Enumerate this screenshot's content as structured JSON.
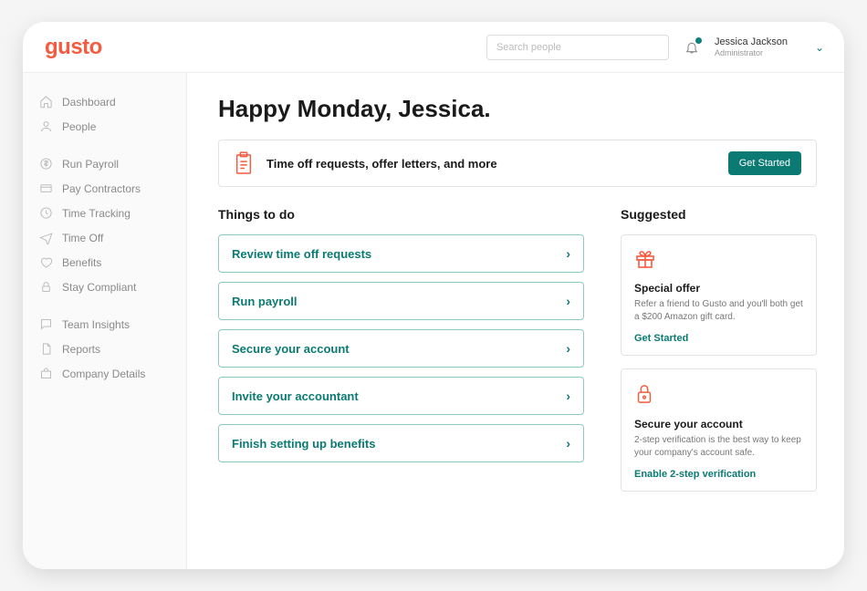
{
  "header": {
    "logo": "gusto",
    "search_placeholder": "Search people",
    "user_name": "Jessica Jackson",
    "user_role": "Administrator"
  },
  "sidebar": {
    "g1": [
      {
        "label": "Dashboard",
        "icon": "home"
      },
      {
        "label": "People",
        "icon": "person"
      }
    ],
    "g2": [
      {
        "label": "Run Payroll",
        "icon": "dollar"
      },
      {
        "label": "Pay Contractors",
        "icon": "card"
      },
      {
        "label": "Time Tracking",
        "icon": "clock"
      },
      {
        "label": "Time Off",
        "icon": "plane"
      },
      {
        "label": "Benefits",
        "icon": "heart"
      },
      {
        "label": "Stay Compliant",
        "icon": "lock"
      }
    ],
    "g3": [
      {
        "label": "Team Insights",
        "icon": "chat"
      },
      {
        "label": "Reports",
        "icon": "doc"
      },
      {
        "label": "Company Details",
        "icon": "bag"
      }
    ]
  },
  "greeting": "Happy Monday, Jessica.",
  "banner": {
    "text": "Time off requests, offer letters, and more",
    "cta": "Get Started"
  },
  "todo": {
    "heading": "Things to do",
    "items": [
      "Review time off requests",
      "Run payroll",
      "Secure your account",
      "Invite your accountant",
      "Finish setting up benefits"
    ]
  },
  "suggested": {
    "heading": "Suggested",
    "cards": [
      {
        "icon": "gift",
        "title": "Special offer",
        "body": "Refer a friend to Gusto and you'll both get a $200 Amazon gift card.",
        "link": "Get Started"
      },
      {
        "icon": "secure-lock",
        "title": "Secure your account",
        "body": "2-step verification is the best way to keep your company's account safe.",
        "link": "Enable 2-step verification"
      }
    ]
  }
}
